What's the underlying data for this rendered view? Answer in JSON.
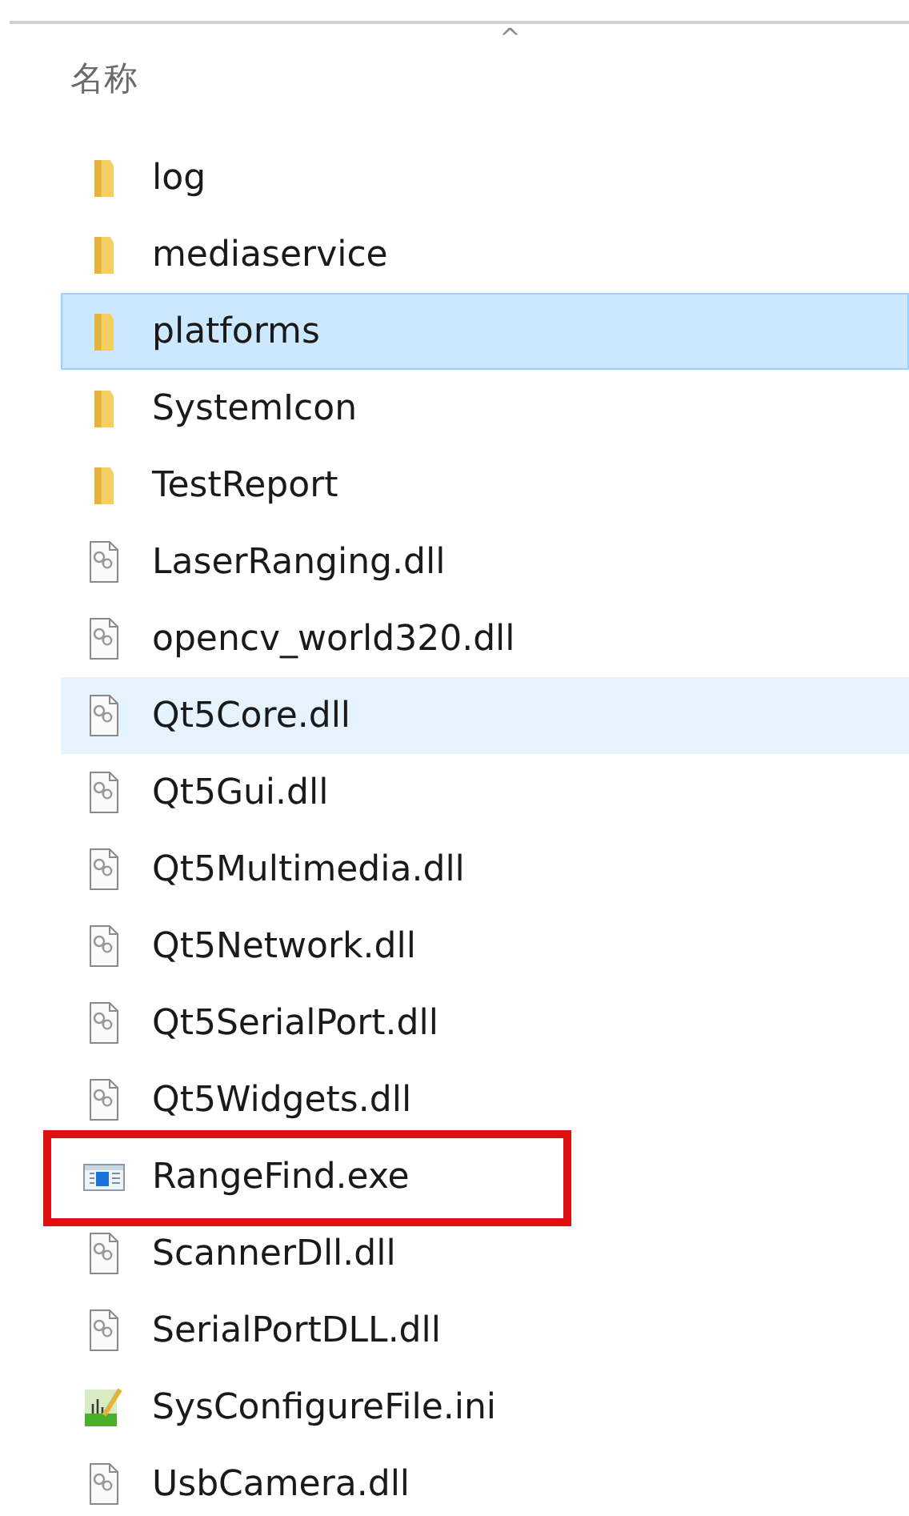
{
  "header": {
    "sort_indicator": "^",
    "column": "名称"
  },
  "files": [
    {
      "name": "log",
      "kind": "folder",
      "selected": false,
      "hovered": false,
      "highlighted": false
    },
    {
      "name": "mediaservice",
      "kind": "folder",
      "selected": false,
      "hovered": false,
      "highlighted": false
    },
    {
      "name": "platforms",
      "kind": "folder",
      "selected": true,
      "hovered": false,
      "highlighted": false
    },
    {
      "name": "SystemIcon",
      "kind": "folder",
      "selected": false,
      "hovered": false,
      "highlighted": false
    },
    {
      "name": "TestReport",
      "kind": "folder",
      "selected": false,
      "hovered": false,
      "highlighted": false
    },
    {
      "name": "LaserRanging.dll",
      "kind": "dll",
      "selected": false,
      "hovered": false,
      "highlighted": false
    },
    {
      "name": "opencv_world320.dll",
      "kind": "dll",
      "selected": false,
      "hovered": false,
      "highlighted": false
    },
    {
      "name": "Qt5Core.dll",
      "kind": "dll",
      "selected": false,
      "hovered": true,
      "highlighted": false
    },
    {
      "name": "Qt5Gui.dll",
      "kind": "dll",
      "selected": false,
      "hovered": false,
      "highlighted": false
    },
    {
      "name": "Qt5Multimedia.dll",
      "kind": "dll",
      "selected": false,
      "hovered": false,
      "highlighted": false
    },
    {
      "name": "Qt5Network.dll",
      "kind": "dll",
      "selected": false,
      "hovered": false,
      "highlighted": false
    },
    {
      "name": "Qt5SerialPort.dll",
      "kind": "dll",
      "selected": false,
      "hovered": false,
      "highlighted": false
    },
    {
      "name": "Qt5Widgets.dll",
      "kind": "dll",
      "selected": false,
      "hovered": false,
      "highlighted": false
    },
    {
      "name": "RangeFind.exe",
      "kind": "exe",
      "selected": false,
      "hovered": false,
      "highlighted": true
    },
    {
      "name": "ScannerDll.dll",
      "kind": "dll",
      "selected": false,
      "hovered": false,
      "highlighted": false
    },
    {
      "name": "SerialPortDLL.dll",
      "kind": "dll",
      "selected": false,
      "hovered": false,
      "highlighted": false
    },
    {
      "name": "SysConfigureFile.ini",
      "kind": "ini",
      "selected": false,
      "hovered": false,
      "highlighted": false
    },
    {
      "name": "UsbCamera.dll",
      "kind": "dll",
      "selected": false,
      "hovered": false,
      "highlighted": false
    }
  ]
}
